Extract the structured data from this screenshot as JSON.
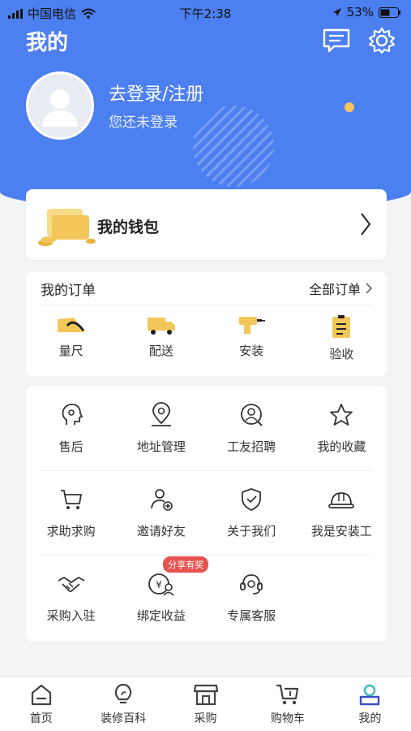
{
  "status_bar": {
    "carrier": "中国电信",
    "time": "下午2:38",
    "battery": "53%"
  },
  "header": {
    "title": "我的"
  },
  "profile": {
    "login_text": "去登录/注册",
    "sub_text": "您还未登录"
  },
  "wallet": {
    "label": "我的钱包"
  },
  "orders": {
    "title": "我的订单",
    "all_label": "全部订单",
    "items": [
      {
        "label": "量尺",
        "icon": "ruler-icon"
      },
      {
        "label": "配送",
        "icon": "truck-icon"
      },
      {
        "label": "安装",
        "icon": "drill-icon"
      },
      {
        "label": "验收",
        "icon": "clipboard-icon"
      }
    ]
  },
  "services": {
    "rows": [
      [
        {
          "label": "售后",
          "icon": "after-sales-icon"
        },
        {
          "label": "地址管理",
          "icon": "location-icon"
        },
        {
          "label": "工友招聘",
          "icon": "recruit-icon"
        },
        {
          "label": "我的收藏",
          "icon": "star-icon"
        }
      ],
      [
        {
          "label": "求助求购",
          "icon": "cart-icon"
        },
        {
          "label": "邀请好友",
          "icon": "add-friend-icon"
        },
        {
          "label": "关于我们",
          "icon": "shield-icon"
        },
        {
          "label": "我是安装工",
          "icon": "helmet-icon"
        }
      ],
      [
        {
          "label": "采购入驻",
          "icon": "handshake-icon"
        },
        {
          "label": "绑定收益",
          "icon": "earnings-icon",
          "badge": "分享有奖"
        },
        {
          "label": "专属客服",
          "icon": "headset-icon"
        }
      ]
    ]
  },
  "tabbar": {
    "items": [
      {
        "label": "首页",
        "icon": "home-icon"
      },
      {
        "label": "装修百科",
        "icon": "bulb-icon"
      },
      {
        "label": "采购",
        "icon": "store-icon"
      },
      {
        "label": "购物车",
        "icon": "shopping-cart-icon"
      },
      {
        "label": "我的",
        "icon": "profile-icon"
      }
    ]
  },
  "colors": {
    "brand": "#4c7ff0",
    "accent": "#f3c65a",
    "badge": "#e6544f",
    "active_tab": "#3cb9c4"
  }
}
